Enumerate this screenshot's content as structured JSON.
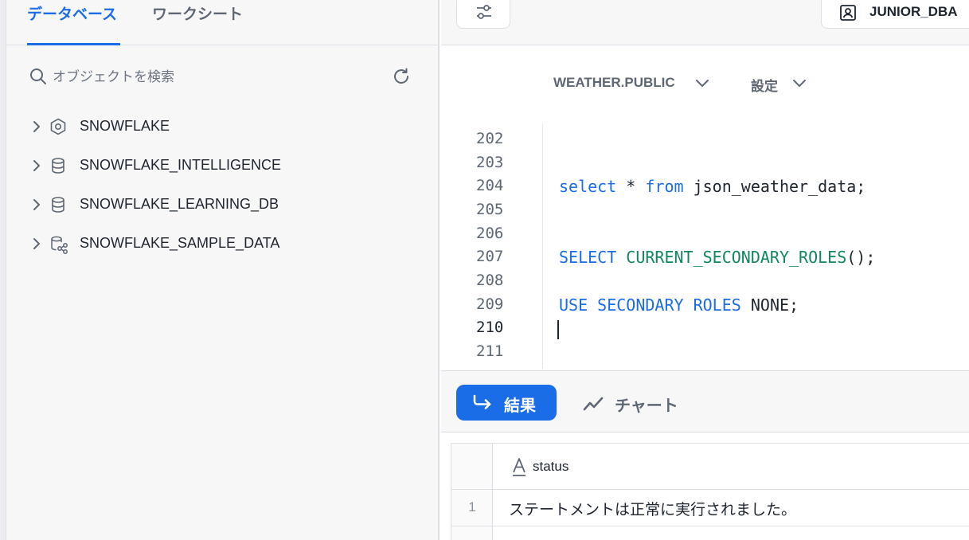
{
  "left_panel": {
    "tabs": [
      {
        "label": "データベース",
        "active": true
      },
      {
        "label": "ワークシート",
        "active": false
      }
    ],
    "search": {
      "placeholder": "オブジェクトを検索",
      "value": ""
    },
    "refresh_icon": "refresh-icon",
    "databases": [
      {
        "label": "SNOWFLAKE",
        "icon": "hexagon-icon"
      },
      {
        "label": "SNOWFLAKE_INTELLIGENCE",
        "icon": "database-icon"
      },
      {
        "label": "SNOWFLAKE_LEARNING_DB",
        "icon": "database-icon"
      },
      {
        "label": "SNOWFLAKE_SAMPLE_DATA",
        "icon": "shared-database-icon"
      }
    ]
  },
  "toolbar": {
    "filter_icon": "sliders-icon",
    "role_label": "JUNIOR_DBA",
    "role_icon": "user-badge-icon"
  },
  "context": {
    "schema_label": "WEATHER.PUBLIC",
    "settings_label": "設定"
  },
  "editor": {
    "line_numbers": [
      "202",
      "203",
      "204",
      "205",
      "206",
      "207",
      "208",
      "209",
      "210",
      "211"
    ],
    "current_line": "210",
    "lines": {
      "l204": {
        "kw1": "select",
        "rest1": " * ",
        "kw2": "from",
        "rest2": " json_weather_data;"
      },
      "l207": {
        "kw1": "SELECT",
        "fn": "CURRENT_SECONDARY_ROLES",
        "rest": "();"
      },
      "l209": {
        "kw1": "USE",
        "kw2": "SECONDARY",
        "kw3": "ROLES",
        "rest": "NONE;"
      }
    }
  },
  "results": {
    "results_label": "結果",
    "chart_label": "チャート",
    "columns": [
      {
        "name": "status",
        "type_icon": "text-type-icon"
      }
    ],
    "rows": [
      {
        "num": "1",
        "status": "ステートメントは正常に実行されました。"
      }
    ]
  },
  "colors": {
    "accent": "#1a6ce7",
    "function_green": "#11875d"
  }
}
